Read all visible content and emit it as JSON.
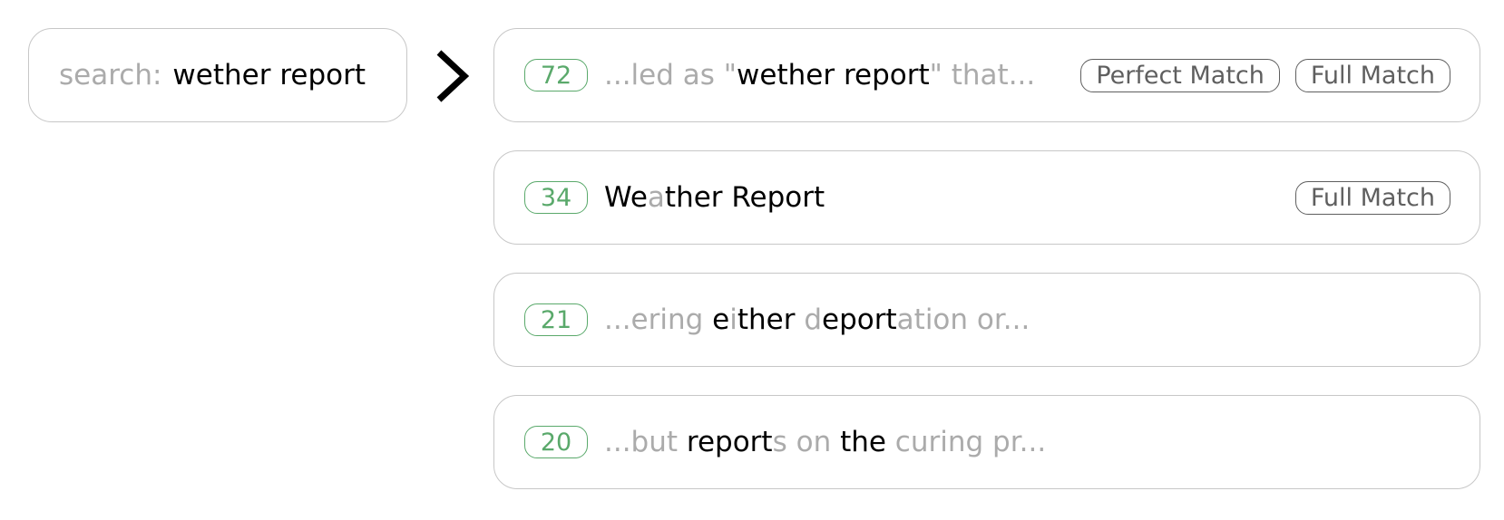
{
  "query": {
    "label": "search:",
    "text": "wether report"
  },
  "results": [
    {
      "score": "72",
      "snippet": [
        {
          "text": "...led as \"",
          "hit": false
        },
        {
          "text": "wether report",
          "hit": true
        },
        {
          "text": "\" that...",
          "hit": false
        }
      ],
      "badges": [
        "Perfect Match",
        "Full Match"
      ]
    },
    {
      "score": "34",
      "snippet": [
        {
          "text": "We",
          "hit": true
        },
        {
          "text": "a",
          "hit": false
        },
        {
          "text": "ther Report",
          "hit": true
        }
      ],
      "badges": [
        "Full Match"
      ]
    },
    {
      "score": "21",
      "snippet": [
        {
          "text": "...ering ",
          "hit": false
        },
        {
          "text": "e",
          "hit": true
        },
        {
          "text": "i",
          "hit": false
        },
        {
          "text": "ther ",
          "hit": true
        },
        {
          "text": "d",
          "hit": false
        },
        {
          "text": "eport",
          "hit": true
        },
        {
          "text": "ation or...",
          "hit": false
        }
      ],
      "badges": []
    },
    {
      "score": "20",
      "snippet": [
        {
          "text": "...but ",
          "hit": false
        },
        {
          "text": "report",
          "hit": true
        },
        {
          "text": "s on ",
          "hit": false
        },
        {
          "text": "the",
          "hit": true
        },
        {
          "text": " curing pr...",
          "hit": false
        }
      ],
      "badges": []
    }
  ],
  "colors": {
    "score_accent": "#5aa96b",
    "dim_text": "#ababab",
    "match_text": "#000000",
    "badge_border": "#5f5f5f"
  },
  "icons": {
    "arrow": "chevron-right-icon"
  }
}
